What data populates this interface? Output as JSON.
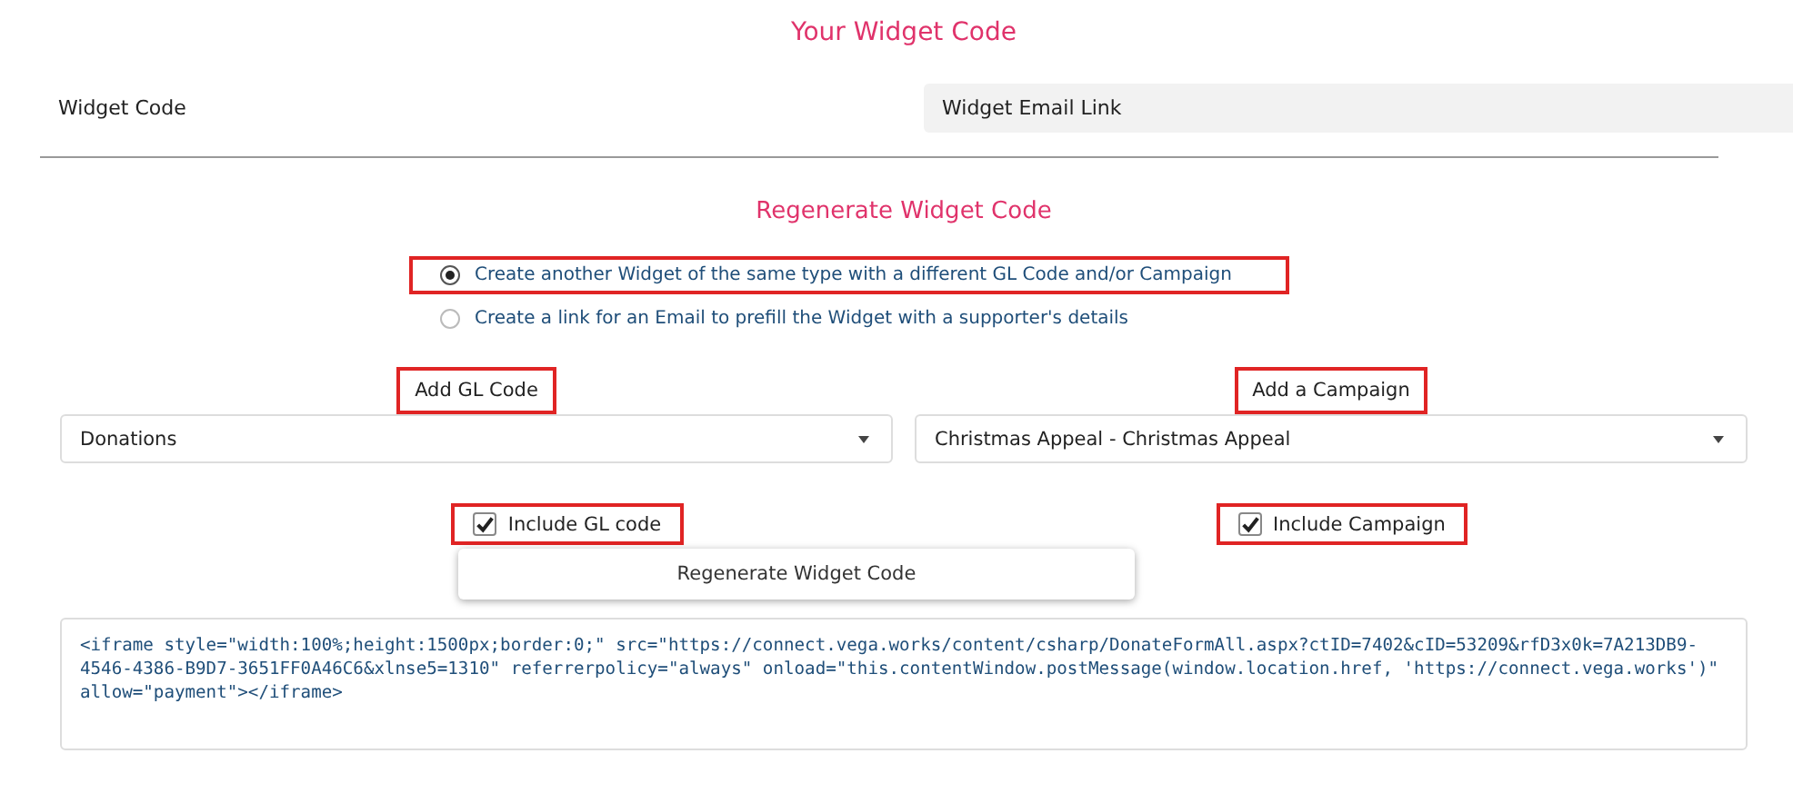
{
  "title": "Your Widget Code",
  "tabs": [
    {
      "label": "Widget Code",
      "selected": false
    },
    {
      "label": "Widget Email Link",
      "selected": true
    }
  ],
  "subtitle": "Regenerate Widget Code",
  "options": [
    {
      "label": "Create another Widget of the same type with a different GL Code and/or Campaign",
      "selected": true,
      "highlighted": true
    },
    {
      "label": "Create a link for an Email to prefill the Widget with a supporter's details",
      "selected": false,
      "highlighted": false
    }
  ],
  "selects": [
    {
      "label": "Add GL Code",
      "label_highlighted": true,
      "value": "Donations",
      "checkbox": {
        "label": "Include GL code",
        "checked": true,
        "highlighted": true
      }
    },
    {
      "label": "Add a Campaign",
      "label_highlighted": true,
      "value": "Christmas Appeal - Christmas Appeal",
      "checkbox": {
        "label": "Include Campaign",
        "checked": true,
        "highlighted": true
      }
    }
  ],
  "button": "Regenerate Widget Code",
  "code": "<iframe style=\"width:100%;height:1500px;border:0;\" src=\"https://connect.vega.works/content/csharp/DonateFormAll.aspx?ctID=7402&cID=53209&rfD3x0k=7A213DB9-4546-4386-B9D7-3651FF0A46C6&xlnse5=1310\" referrerpolicy=\"always\" onload=\"this.contentWindow.postMessage(window.location.href, 'https://connect.vega.works')\" allow=\"payment\"></iframe>"
}
